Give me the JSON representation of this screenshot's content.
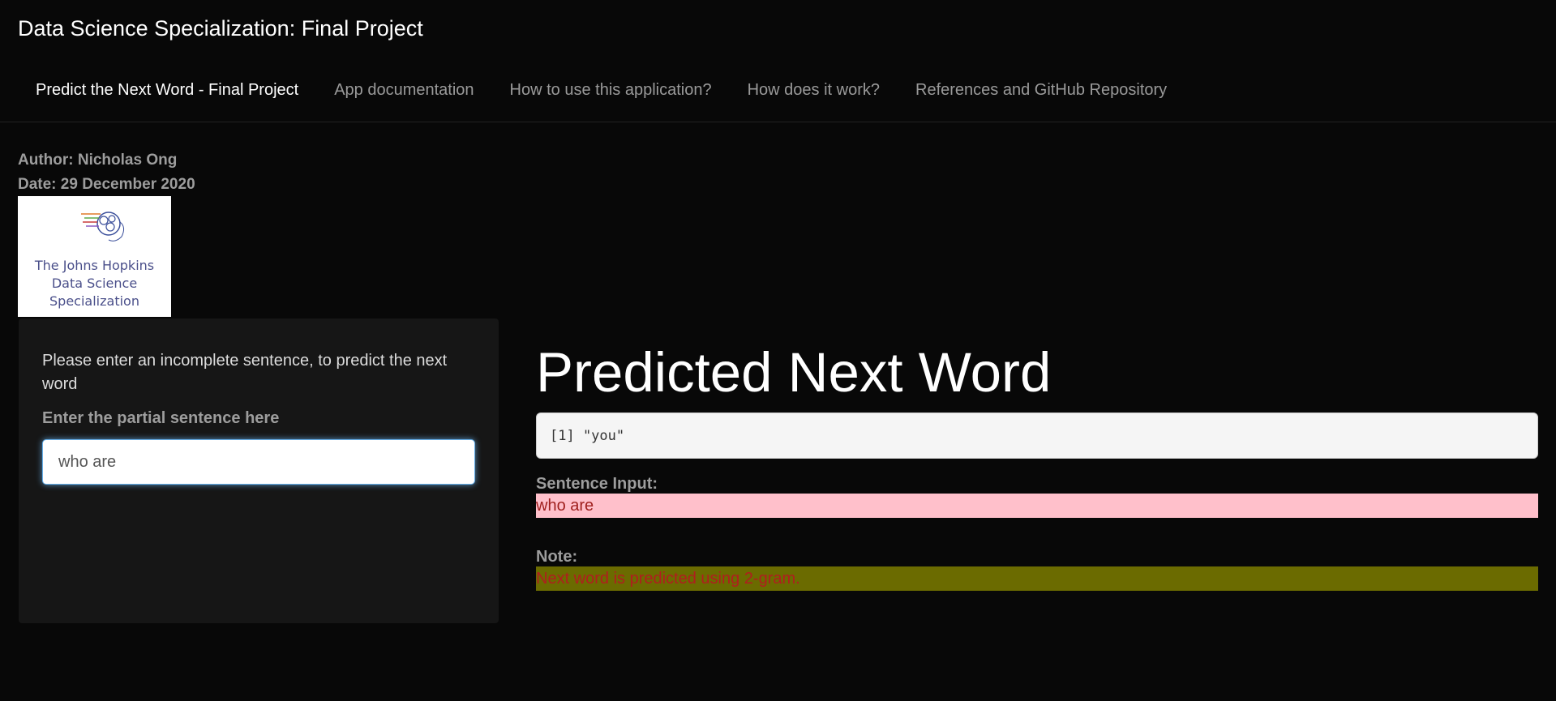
{
  "app": {
    "title": "Data Science Specialization: Final Project"
  },
  "nav": {
    "tabs": [
      {
        "label": "Predict the Next Word - Final Project",
        "active": true
      },
      {
        "label": "App documentation",
        "active": false
      },
      {
        "label": "How to use this application?",
        "active": false
      },
      {
        "label": "How does it work?",
        "active": false
      },
      {
        "label": "References and GitHub Repository",
        "active": false
      }
    ]
  },
  "meta": {
    "author": "Author: Nicholas Ong",
    "date": "Date: 29 December 2020"
  },
  "logo": {
    "line1": "The Johns Hopkins",
    "line2": "Data Science",
    "line3": "Specialization"
  },
  "sidebar": {
    "instruction": "Please enter an incomplete sentence, to predict the next word",
    "input_label": "Enter the partial sentence here",
    "input_value": "who are"
  },
  "main": {
    "title": "Predicted Next Word",
    "output": "[1] \"you\"",
    "sentence_label": "Sentence Input:",
    "sentence_value": "who are",
    "note_label": "Note:",
    "note_value": "Next word is predicted using 2-gram."
  },
  "colors": {
    "background": "#080808",
    "sentence_bg": "#ffc0cb",
    "note_bg": "#6b6b00",
    "text_red": "#a0201e"
  }
}
